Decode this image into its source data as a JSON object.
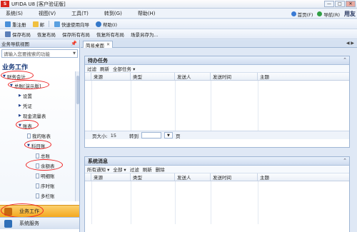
{
  "window": {
    "logo": "S",
    "title": "UFIDA U8 [客户验证版]",
    "min": "—",
    "max": "□",
    "close": "✕"
  },
  "menubar": {
    "items": [
      "系统(S)",
      "视图(V)",
      "工具(T)",
      "转到(G)",
      "帮助(H)"
    ],
    "home": "首页(F)",
    "nav": "导航(R)",
    "brand": "用友"
  },
  "toolbar1": {
    "reregister": "重注册",
    "email": "邮",
    "quick_wizard": "快速使用向导",
    "help": "帮助(I)"
  },
  "toolbar2": {
    "save_layout": "保存布局",
    "restore_layout": "恢复布局",
    "save_all": "保存所有布局",
    "restore_all": "恢复所有布局",
    "save_as": "场景另存为..."
  },
  "sidebar": {
    "header": "业务导航视图",
    "pin": "📌",
    "search_placeholder": "请输入您要搜索的功能",
    "section_title": "业务工作",
    "tree": {
      "finance": "财务会计",
      "general_ledger": "总账[演示版]",
      "settings": "设置",
      "voucher": "凭证",
      "cashflow": "现金流量表",
      "books": "账表",
      "my_books": "我的账表",
      "subject_books": "科目账",
      "total": "总账",
      "balance": "余额表",
      "detail": "明细账",
      "sequence": "序时账",
      "multi": "多栏账"
    },
    "business_work": "业务工作",
    "system_service": "系统服务"
  },
  "tabs": {
    "desktop": "简易桌面",
    "close": "✕"
  },
  "todo": {
    "title": "待办任务",
    "tools": [
      "过滤",
      "刷新",
      "全部任务 ▾"
    ],
    "columns": [
      "来源",
      "类型",
      "发送人",
      "发送时间",
      "主题"
    ],
    "page_size_label": "页大小:",
    "page_size": "15",
    "goto_label": "转到",
    "page_label": "页"
  },
  "messages": {
    "title": "系统消息",
    "tools": [
      "所有通知 ▾",
      "全部 ▾",
      "过滤",
      "刷新",
      "删除"
    ],
    "columns": [
      "来源",
      "类型",
      "发送人",
      "发送时间",
      "主题"
    ]
  },
  "colors": {
    "highlight_oval": "#e22222",
    "accent": "#f4a81f",
    "nav_blue": "#1b3b7a"
  }
}
